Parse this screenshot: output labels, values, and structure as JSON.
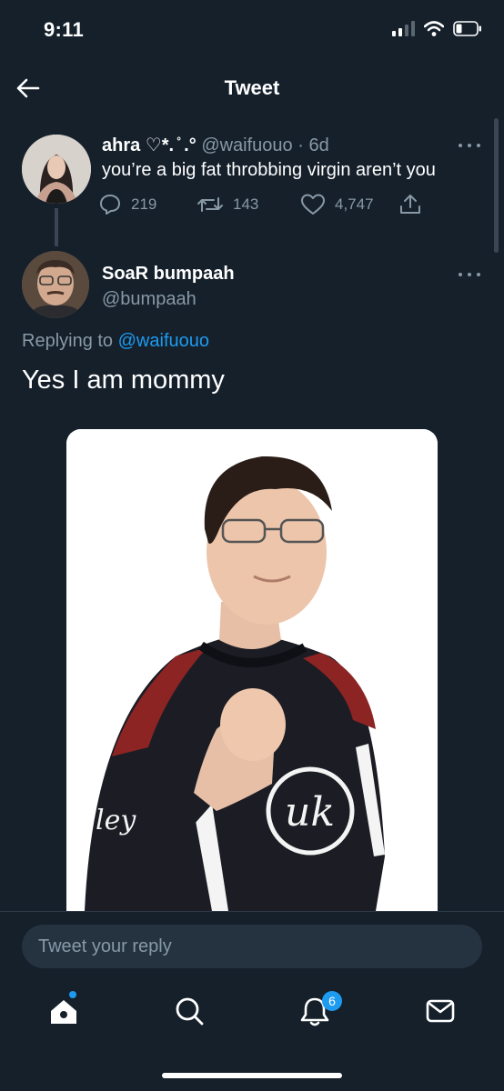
{
  "status_bar": {
    "time": "9:11",
    "icons": [
      "cellular-signal-icon",
      "wifi-icon",
      "battery-icon"
    ]
  },
  "header": {
    "title": "Tweet",
    "back_icon": "arrow-left-icon"
  },
  "parent_tweet": {
    "display_name": "ahra ♡*. ̊ .°",
    "handle": "@waifuouo",
    "time_separator": "·",
    "time": "6d",
    "text": "you’re a big fat throbbing virgin aren’t you",
    "stats": {
      "replies": "219",
      "retweets": "143",
      "likes": "4,747"
    },
    "more_icon": "more-horizontal-icon"
  },
  "main_tweet": {
    "display_name": "SoaR bumpaah",
    "handle": "@bumpaah",
    "replying_prefix": "Replying to ",
    "replying_to": "@waifuouo",
    "text": "Yes I am mommy",
    "media_alt": "photo",
    "more_icon": "more-horizontal-icon"
  },
  "reply_bar": {
    "placeholder": "Tweet your reply"
  },
  "bottom_nav": {
    "items": [
      "home-icon",
      "search-icon",
      "notifications-icon",
      "messages-icon"
    ],
    "notification_count": "6"
  },
  "colors": {
    "background": "#15202b",
    "accent": "#1d9bf0",
    "muted_text": "#8899a6",
    "divider": "#2f3b47"
  }
}
